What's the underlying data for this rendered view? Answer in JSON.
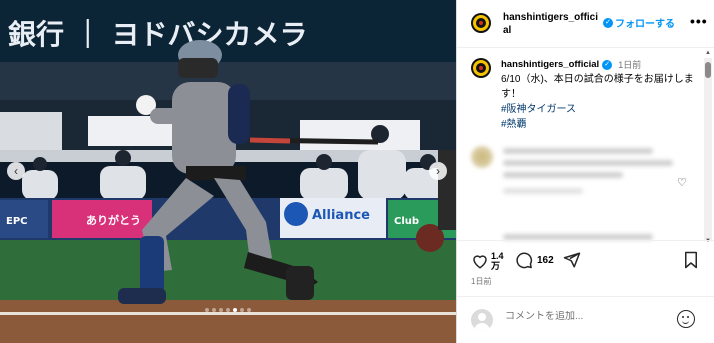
{
  "post": {
    "username": "hanshintigers_official",
    "follow_label": "フォローする",
    "more_label": "•••",
    "caption": {
      "username": "hanshintigers_official",
      "time": "1日前",
      "text": "6/10（水)、本日の試合の様子をお届けします！",
      "hashtags": [
        "#阪神タイガース",
        "#熱覇"
      ]
    },
    "likes": {
      "line1": "1.4",
      "line2": "万"
    },
    "comments_count": "162",
    "date": "1日前",
    "comment_placeholder": "コメントを追加...",
    "carousel": {
      "slide_count": 7,
      "active_index": 4
    }
  },
  "photo": {
    "banner_text": "銀行 ｜ ヨドバシカメラ",
    "ads": {
      "alliance": "Alliance",
      "epc": "EPC",
      "left_sign": "ありがとう",
      "club_sign": "Club"
    }
  },
  "colors": {
    "accent": "#0095f6",
    "tag": "#00376b",
    "tigers_yellow": "#f5c300"
  }
}
